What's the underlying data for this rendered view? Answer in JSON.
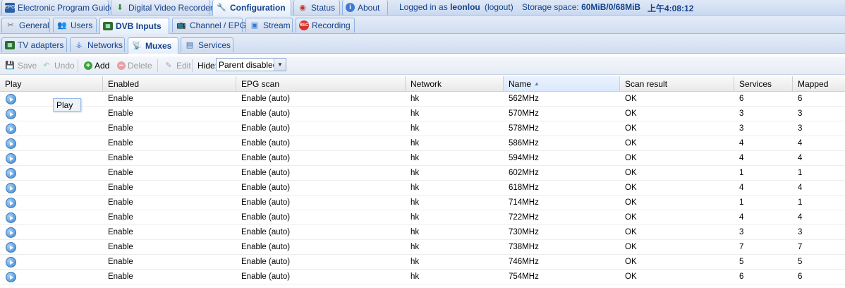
{
  "top_tabs": [
    {
      "label": "Electronic Program Guide",
      "icon": "epg-icon"
    },
    {
      "label": "Digital Video Recorder",
      "icon": "dvr-icon"
    },
    {
      "label": "Configuration",
      "icon": "wrench-icon"
    },
    {
      "label": "Status",
      "icon": "eye-icon"
    },
    {
      "label": "About",
      "icon": "info-icon"
    }
  ],
  "status": {
    "logged_in_prefix": "Logged in as",
    "username": "leonlou",
    "logout": "(logout)",
    "storage_prefix": "Storage space:",
    "storage_value": "60MiB/0/68MiB",
    "time": "上午4:08:12"
  },
  "config_tabs": [
    {
      "label": "General",
      "icon": "tools-icon"
    },
    {
      "label": "Users",
      "icon": "users-icon"
    },
    {
      "label": "DVB Inputs",
      "icon": "dvb-card-icon"
    },
    {
      "label": "Channel / EPG",
      "icon": "tv-icon"
    },
    {
      "label": "Stream",
      "icon": "stream-icon"
    },
    {
      "label": "Recording",
      "icon": "rec-icon"
    }
  ],
  "dvb_tabs": [
    {
      "label": "TV adapters",
      "icon": "adapter-icon"
    },
    {
      "label": "Networks",
      "icon": "antenna-icon"
    },
    {
      "label": "Muxes",
      "icon": "satellite-dish-icon"
    },
    {
      "label": "Services",
      "icon": "services-icon"
    }
  ],
  "toolbar": {
    "save": "Save",
    "undo": "Undo",
    "add": "Add",
    "delete": "Delete",
    "edit": "Edit",
    "hide_label": "Hide:",
    "hide_value": "Parent disabled"
  },
  "columns": [
    "Play",
    "Enabled",
    "EPG scan",
    "Network",
    "Name",
    "Scan result",
    "Services",
    "Mapped"
  ],
  "rows": [
    {
      "enabled": "Enable",
      "epg": "Enable (auto)",
      "network": "hk",
      "name": "562MHz",
      "scan": "OK",
      "services": "6",
      "mapped": "6"
    },
    {
      "enabled": "Enable",
      "epg": "Enable (auto)",
      "network": "hk",
      "name": "570MHz",
      "scan": "OK",
      "services": "3",
      "mapped": "3"
    },
    {
      "enabled": "Enable",
      "epg": "Enable (auto)",
      "network": "hk",
      "name": "578MHz",
      "scan": "OK",
      "services": "3",
      "mapped": "3"
    },
    {
      "enabled": "Enable",
      "epg": "Enable (auto)",
      "network": "hk",
      "name": "586MHz",
      "scan": "OK",
      "services": "4",
      "mapped": "4"
    },
    {
      "enabled": "Enable",
      "epg": "Enable (auto)",
      "network": "hk",
      "name": "594MHz",
      "scan": "OK",
      "services": "4",
      "mapped": "4"
    },
    {
      "enabled": "Enable",
      "epg": "Enable (auto)",
      "network": "hk",
      "name": "602MHz",
      "scan": "OK",
      "services": "1",
      "mapped": "1"
    },
    {
      "enabled": "Enable",
      "epg": "Enable (auto)",
      "network": "hk",
      "name": "618MHz",
      "scan": "OK",
      "services": "4",
      "mapped": "4"
    },
    {
      "enabled": "Enable",
      "epg": "Enable (auto)",
      "network": "hk",
      "name": "714MHz",
      "scan": "OK",
      "services": "1",
      "mapped": "1"
    },
    {
      "enabled": "Enable",
      "epg": "Enable (auto)",
      "network": "hk",
      "name": "722MHz",
      "scan": "OK",
      "services": "4",
      "mapped": "4"
    },
    {
      "enabled": "Enable",
      "epg": "Enable (auto)",
      "network": "hk",
      "name": "730MHz",
      "scan": "OK",
      "services": "3",
      "mapped": "3"
    },
    {
      "enabled": "Enable",
      "epg": "Enable (auto)",
      "network": "hk",
      "name": "738MHz",
      "scan": "OK",
      "services": "7",
      "mapped": "7"
    },
    {
      "enabled": "Enable",
      "epg": "Enable (auto)",
      "network": "hk",
      "name": "746MHz",
      "scan": "OK",
      "services": "5",
      "mapped": "5"
    },
    {
      "enabled": "Enable",
      "epg": "Enable (auto)",
      "network": "hk",
      "name": "754MHz",
      "scan": "OK",
      "services": "6",
      "mapped": "6"
    }
  ],
  "tooltip": "Play"
}
